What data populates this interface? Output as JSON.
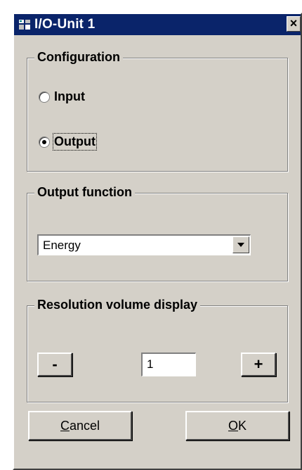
{
  "window": {
    "title": "I/O-Unit 1",
    "close_glyph": "×",
    "icon": "app-icon"
  },
  "configuration": {
    "legend": "Configuration",
    "options": [
      {
        "label": "Input",
        "selected": false
      },
      {
        "label": "Output",
        "selected": true
      }
    ]
  },
  "output_function": {
    "legend": "Output function",
    "selected": "Energy"
  },
  "resolution": {
    "legend": "Resolution volume display",
    "minus_label": "-",
    "plus_label": "+",
    "value": "1"
  },
  "buttons": {
    "cancel_first": "C",
    "cancel_rest": "ancel",
    "ok_first": "O",
    "ok_rest": "K"
  },
  "colors": {
    "face": "#d4d0c8",
    "titlebar": "#0a246a"
  }
}
